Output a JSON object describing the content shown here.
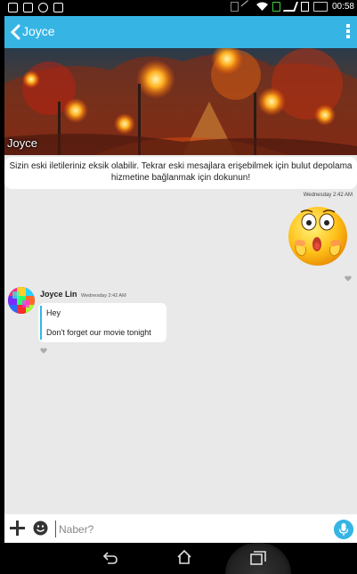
{
  "status_bar": {
    "time": "00:58",
    "icons": [
      "calendar-icon",
      "image-icon",
      "chat-icon",
      "photo-icon",
      "vibrate-icon",
      "no-signal-icon",
      "wifi-icon",
      "sim-icon",
      "signal-icon",
      "data-icon",
      "battery-icon"
    ]
  },
  "app_bar": {
    "title": "Joyce",
    "back_icon": "chevron-left-icon",
    "menu_icon": "overflow-menu-icon",
    "color": "#36b5e5"
  },
  "banner": {
    "name": "Joyce"
  },
  "notice": {
    "line1": "Sizin eski iletileriniz eksik olabilir. Tekrar eski mesajlara erişebilmek için bulut depolama",
    "line2": "hizmetine bağlanmak için dokunun!"
  },
  "outgoing": {
    "timestamp": "Wednesday 2:42 AM",
    "sticker": "surprised-emoji"
  },
  "incoming": {
    "sender": "Joyce Lin",
    "timestamp": "Wednesday 2:42 AM",
    "messages": [
      "Hey",
      "Don't forget our movie tonight"
    ]
  },
  "composer": {
    "placeholder": "Naber?",
    "add_icon": "plus-icon",
    "emoji_icon": "smiley-icon",
    "mic_icon": "microphone-icon"
  },
  "nav_bar": {
    "icons": [
      "back-icon",
      "home-icon",
      "recent-apps-icon"
    ]
  }
}
